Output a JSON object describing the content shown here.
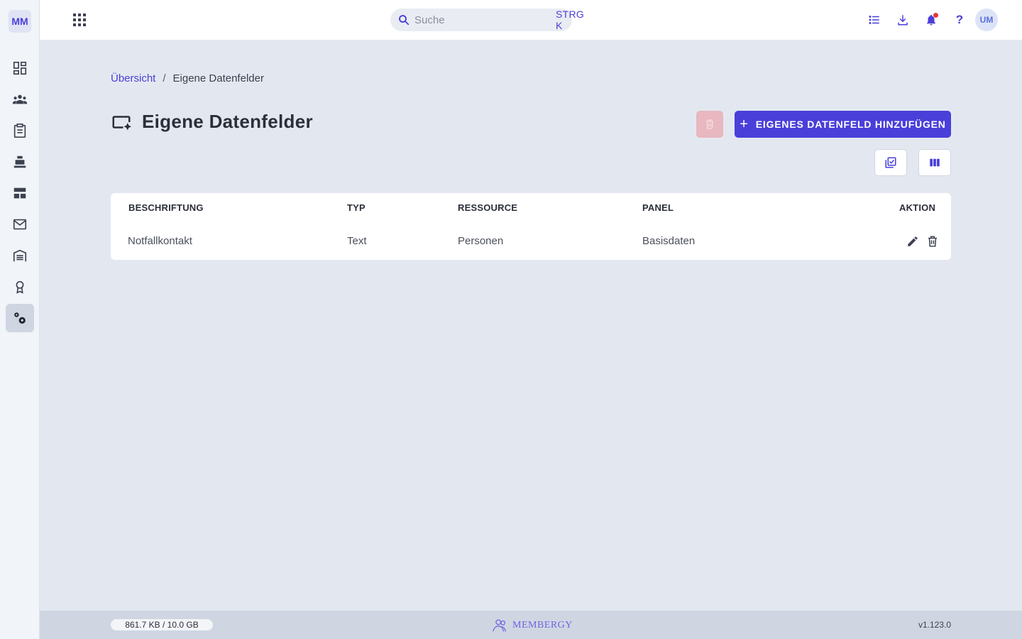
{
  "app": {
    "logo_text": "MM",
    "brand_name": "MEMBERGY",
    "version": "v1.123.0"
  },
  "sidebar": {
    "items": [
      {
        "icon": "dashboard-icon",
        "active": false
      },
      {
        "icon": "people-icon",
        "active": false
      },
      {
        "icon": "clipboard-icon",
        "active": false
      },
      {
        "icon": "cash-register-icon",
        "active": false
      },
      {
        "icon": "table-layout-icon",
        "active": false
      },
      {
        "icon": "mail-icon",
        "active": false
      },
      {
        "icon": "warehouse-icon",
        "active": false
      },
      {
        "icon": "award-icon",
        "active": false
      },
      {
        "icon": "settings-gears-icon",
        "active": true
      }
    ]
  },
  "topbar": {
    "search_placeholder": "Suche",
    "search_shortcut": "STRG K",
    "avatar_initials": "UM",
    "has_notification": true
  },
  "breadcrumb": {
    "link": "Übersicht",
    "separator": "/",
    "current": "Eigene Datenfelder"
  },
  "page": {
    "title": "Eigene Datenfelder",
    "add_button_label": "EIGENES DATENFELD HINZUFÜGEN"
  },
  "table": {
    "columns": [
      "BESCHRIFTUNG",
      "TYP",
      "RESSOURCE",
      "PANEL",
      "AKTION"
    ],
    "rows": [
      {
        "beschriftung": "Notfallkontakt",
        "typ": "Text",
        "ressource": "Personen",
        "panel": "Basisdaten"
      }
    ]
  },
  "footer": {
    "storage": "861.7 KB / 10.0 GB"
  },
  "colors": {
    "accent": "#4a3fd9",
    "danger_disabled": "#e8b7bf",
    "background": "#e3e8f0"
  }
}
